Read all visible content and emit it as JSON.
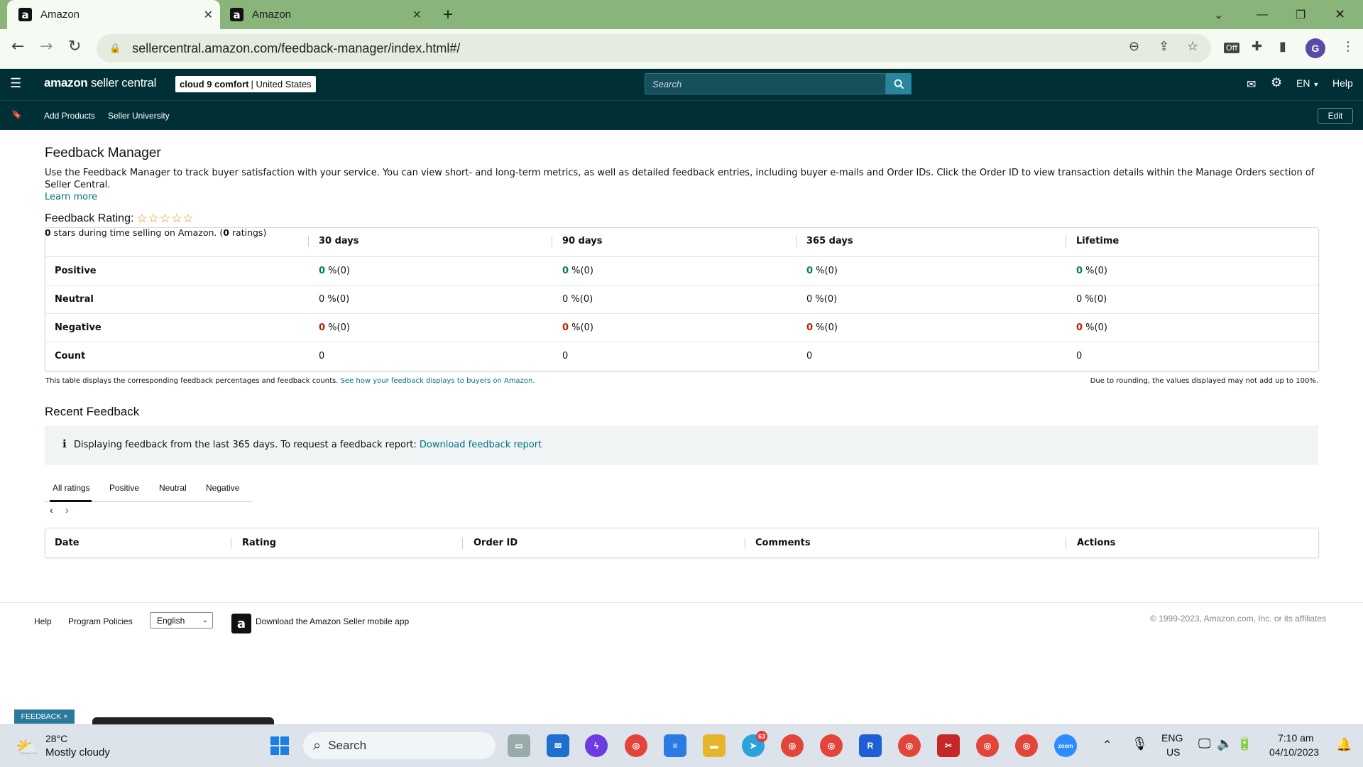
{
  "browser": {
    "tabs": [
      {
        "title": "Amazon",
        "favicon": "a"
      },
      {
        "title": "Amazon",
        "favicon": "a"
      }
    ],
    "new_tab": "+",
    "url": "sellercentral.amazon.com/feedback-manager/index.html#/",
    "profile_initial": "G",
    "ext_badge": "Off"
  },
  "header": {
    "logo_brand": "amazon",
    "logo_product": "seller central",
    "store_name": "cloud 9 comfort",
    "store_region": "United States",
    "search_placeholder": "Search",
    "language": "EN",
    "help": "Help"
  },
  "subnav": {
    "items": [
      "Add Products",
      "Seller University"
    ],
    "edit": "Edit"
  },
  "page": {
    "title": "Feedback Manager",
    "description": "Use the Feedback Manager to track buyer satisfaction with your service. You can view short- and long-term metrics, as well as detailed feedback entries, including buyer e-mails and Order IDs. Click the Order ID to view transaction details within the Manage Orders section of Seller Central.",
    "learn_more": "Learn more",
    "rating_label": "Feedback Rating:",
    "rating_stars_value": 0,
    "stars_text_value": "0",
    "stars_text_middle": " stars during time selling on Amazon. (",
    "ratings_count": "0",
    "ratings_text_end": " ratings)"
  },
  "feedback_table": {
    "columns": [
      "30 days",
      "90 days",
      "365 days",
      "Lifetime"
    ],
    "rows": [
      {
        "label": "Positive",
        "type": "positive",
        "values": [
          {
            "pct": "0",
            "rest": " %(0)"
          },
          {
            "pct": "0",
            "rest": " %(0)"
          },
          {
            "pct": "0",
            "rest": " %(0)"
          },
          {
            "pct": "0",
            "rest": " %(0)"
          }
        ]
      },
      {
        "label": "Neutral",
        "type": "neutral",
        "values": [
          {
            "pct": "0",
            "rest": " %(0)"
          },
          {
            "pct": "0",
            "rest": " %(0)"
          },
          {
            "pct": "0",
            "rest": " %(0)"
          },
          {
            "pct": "0",
            "rest": " %(0)"
          }
        ]
      },
      {
        "label": "Negative",
        "type": "negative",
        "values": [
          {
            "pct": "0",
            "rest": " %(0)"
          },
          {
            "pct": "0",
            "rest": " %(0)"
          },
          {
            "pct": "0",
            "rest": " %(0)"
          },
          {
            "pct": "0",
            "rest": " %(0)"
          }
        ]
      },
      {
        "label": "Count",
        "type": "count",
        "values": [
          {
            "pct": "0",
            "rest": ""
          },
          {
            "pct": "0",
            "rest": ""
          },
          {
            "pct": "0",
            "rest": ""
          },
          {
            "pct": "0",
            "rest": ""
          }
        ]
      }
    ],
    "footnote_left": "This table displays the corresponding feedback percentages and feedback counts.",
    "footnote_link": "See how your feedback displays to buyers on Amazon.",
    "footnote_right": "Due to rounding, the values displayed may not add up to 100%."
  },
  "recent": {
    "title": "Recent Feedback",
    "info_text": "Displaying feedback from the last 365 days. To request a feedback report:",
    "info_link": "Download feedback report",
    "tabs": [
      "All ratings",
      "Positive",
      "Neutral",
      "Negative"
    ],
    "columns": [
      "Date",
      "Rating",
      "Order ID",
      "Comments",
      "Actions"
    ]
  },
  "footer": {
    "help": "Help",
    "policies": "Program Policies",
    "language": "English",
    "app_text": "Download the Amazon Seller mobile app",
    "copyright": "© 1999-2023, Amazon.com, Inc. or its affiliates",
    "feedback_tag": "FEEDBACK ×"
  },
  "taskbar": {
    "weather_temp": "28°C",
    "weather_desc": "Mostly cloudy",
    "search": "Search",
    "telegram_badge": "63",
    "lang_top": "ENG",
    "lang_bottom": "US",
    "time": "7:10 am",
    "date": "04/10/2023"
  },
  "colors": {
    "header_bg": "#002f36",
    "link": "#007185",
    "positive": "#067d62",
    "negative": "#b12704",
    "tab_bar": "#8ab57a"
  }
}
